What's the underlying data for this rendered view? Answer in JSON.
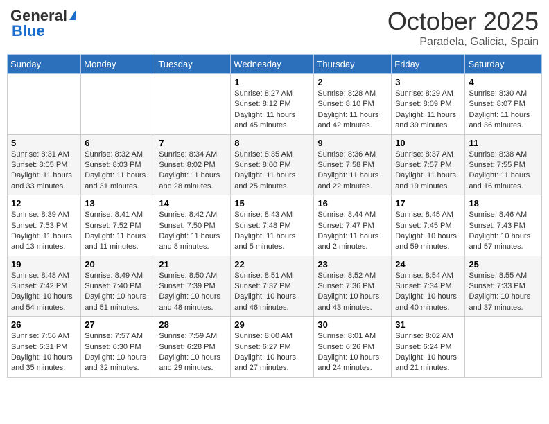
{
  "header": {
    "logo_general": "General",
    "logo_blue": "Blue",
    "month": "October 2025",
    "location": "Paradela, Galicia, Spain"
  },
  "days_of_week": [
    "Sunday",
    "Monday",
    "Tuesday",
    "Wednesday",
    "Thursday",
    "Friday",
    "Saturday"
  ],
  "weeks": [
    [
      {
        "day": "",
        "info": ""
      },
      {
        "day": "",
        "info": ""
      },
      {
        "day": "",
        "info": ""
      },
      {
        "day": "1",
        "info": "Sunrise: 8:27 AM\nSunset: 8:12 PM\nDaylight: 11 hours and 45 minutes."
      },
      {
        "day": "2",
        "info": "Sunrise: 8:28 AM\nSunset: 8:10 PM\nDaylight: 11 hours and 42 minutes."
      },
      {
        "day": "3",
        "info": "Sunrise: 8:29 AM\nSunset: 8:09 PM\nDaylight: 11 hours and 39 minutes."
      },
      {
        "day": "4",
        "info": "Sunrise: 8:30 AM\nSunset: 8:07 PM\nDaylight: 11 hours and 36 minutes."
      }
    ],
    [
      {
        "day": "5",
        "info": "Sunrise: 8:31 AM\nSunset: 8:05 PM\nDaylight: 11 hours and 33 minutes."
      },
      {
        "day": "6",
        "info": "Sunrise: 8:32 AM\nSunset: 8:03 PM\nDaylight: 11 hours and 31 minutes."
      },
      {
        "day": "7",
        "info": "Sunrise: 8:34 AM\nSunset: 8:02 PM\nDaylight: 11 hours and 28 minutes."
      },
      {
        "day": "8",
        "info": "Sunrise: 8:35 AM\nSunset: 8:00 PM\nDaylight: 11 hours and 25 minutes."
      },
      {
        "day": "9",
        "info": "Sunrise: 8:36 AM\nSunset: 7:58 PM\nDaylight: 11 hours and 22 minutes."
      },
      {
        "day": "10",
        "info": "Sunrise: 8:37 AM\nSunset: 7:57 PM\nDaylight: 11 hours and 19 minutes."
      },
      {
        "day": "11",
        "info": "Sunrise: 8:38 AM\nSunset: 7:55 PM\nDaylight: 11 hours and 16 minutes."
      }
    ],
    [
      {
        "day": "12",
        "info": "Sunrise: 8:39 AM\nSunset: 7:53 PM\nDaylight: 11 hours and 13 minutes."
      },
      {
        "day": "13",
        "info": "Sunrise: 8:41 AM\nSunset: 7:52 PM\nDaylight: 11 hours and 11 minutes."
      },
      {
        "day": "14",
        "info": "Sunrise: 8:42 AM\nSunset: 7:50 PM\nDaylight: 11 hours and 8 minutes."
      },
      {
        "day": "15",
        "info": "Sunrise: 8:43 AM\nSunset: 7:48 PM\nDaylight: 11 hours and 5 minutes."
      },
      {
        "day": "16",
        "info": "Sunrise: 8:44 AM\nSunset: 7:47 PM\nDaylight: 11 hours and 2 minutes."
      },
      {
        "day": "17",
        "info": "Sunrise: 8:45 AM\nSunset: 7:45 PM\nDaylight: 10 hours and 59 minutes."
      },
      {
        "day": "18",
        "info": "Sunrise: 8:46 AM\nSunset: 7:43 PM\nDaylight: 10 hours and 57 minutes."
      }
    ],
    [
      {
        "day": "19",
        "info": "Sunrise: 8:48 AM\nSunset: 7:42 PM\nDaylight: 10 hours and 54 minutes."
      },
      {
        "day": "20",
        "info": "Sunrise: 8:49 AM\nSunset: 7:40 PM\nDaylight: 10 hours and 51 minutes."
      },
      {
        "day": "21",
        "info": "Sunrise: 8:50 AM\nSunset: 7:39 PM\nDaylight: 10 hours and 48 minutes."
      },
      {
        "day": "22",
        "info": "Sunrise: 8:51 AM\nSunset: 7:37 PM\nDaylight: 10 hours and 46 minutes."
      },
      {
        "day": "23",
        "info": "Sunrise: 8:52 AM\nSunset: 7:36 PM\nDaylight: 10 hours and 43 minutes."
      },
      {
        "day": "24",
        "info": "Sunrise: 8:54 AM\nSunset: 7:34 PM\nDaylight: 10 hours and 40 minutes."
      },
      {
        "day": "25",
        "info": "Sunrise: 8:55 AM\nSunset: 7:33 PM\nDaylight: 10 hours and 37 minutes."
      }
    ],
    [
      {
        "day": "26",
        "info": "Sunrise: 7:56 AM\nSunset: 6:31 PM\nDaylight: 10 hours and 35 minutes."
      },
      {
        "day": "27",
        "info": "Sunrise: 7:57 AM\nSunset: 6:30 PM\nDaylight: 10 hours and 32 minutes."
      },
      {
        "day": "28",
        "info": "Sunrise: 7:59 AM\nSunset: 6:28 PM\nDaylight: 10 hours and 29 minutes."
      },
      {
        "day": "29",
        "info": "Sunrise: 8:00 AM\nSunset: 6:27 PM\nDaylight: 10 hours and 27 minutes."
      },
      {
        "day": "30",
        "info": "Sunrise: 8:01 AM\nSunset: 6:26 PM\nDaylight: 10 hours and 24 minutes."
      },
      {
        "day": "31",
        "info": "Sunrise: 8:02 AM\nSunset: 6:24 PM\nDaylight: 10 hours and 21 minutes."
      },
      {
        "day": "",
        "info": ""
      }
    ]
  ]
}
